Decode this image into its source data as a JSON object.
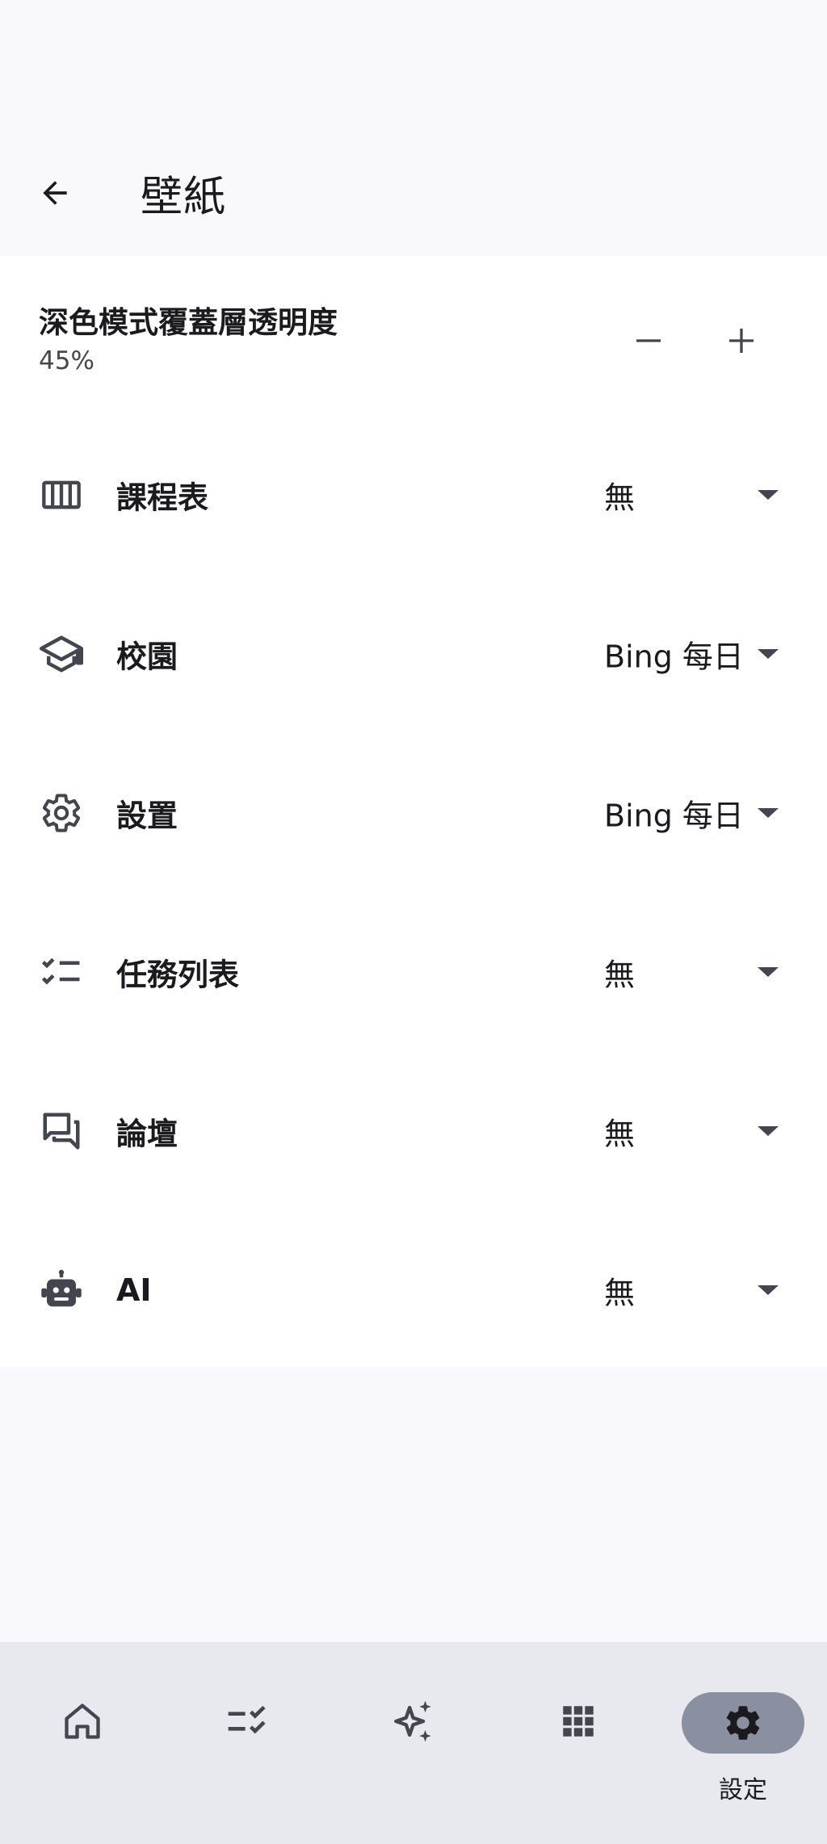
{
  "header": {
    "title": "壁紙"
  },
  "opacity": {
    "title": "深色模式覆蓋層透明度",
    "value": "45%"
  },
  "rows": [
    {
      "icon": "timetable-icon",
      "label": "課程表",
      "value": "無"
    },
    {
      "icon": "school-icon",
      "label": "校園",
      "value": "Bing 每日"
    },
    {
      "icon": "gear-icon",
      "label": "設置",
      "value": "Bing 每日"
    },
    {
      "icon": "checklist-icon",
      "label": "任務列表",
      "value": "無"
    },
    {
      "icon": "forum-icon",
      "label": "論壇",
      "value": "無"
    },
    {
      "icon": "robot-icon",
      "label": "AI",
      "value": "無"
    }
  ],
  "bottom_nav": {
    "items": [
      {
        "icon": "home-icon"
      },
      {
        "icon": "checklist-icon"
      },
      {
        "icon": "sparkle-icon"
      },
      {
        "icon": "apps-grid-icon"
      },
      {
        "icon": "settings-gear-icon",
        "label": "設定",
        "active": true
      }
    ]
  },
  "colors": {
    "background": "#f8f8fd",
    "surface": "#ffffff",
    "nav_background": "#e8e9ef",
    "active_pill": "#8a909f",
    "icon": "#44464f",
    "text": "#1b1b1f"
  }
}
